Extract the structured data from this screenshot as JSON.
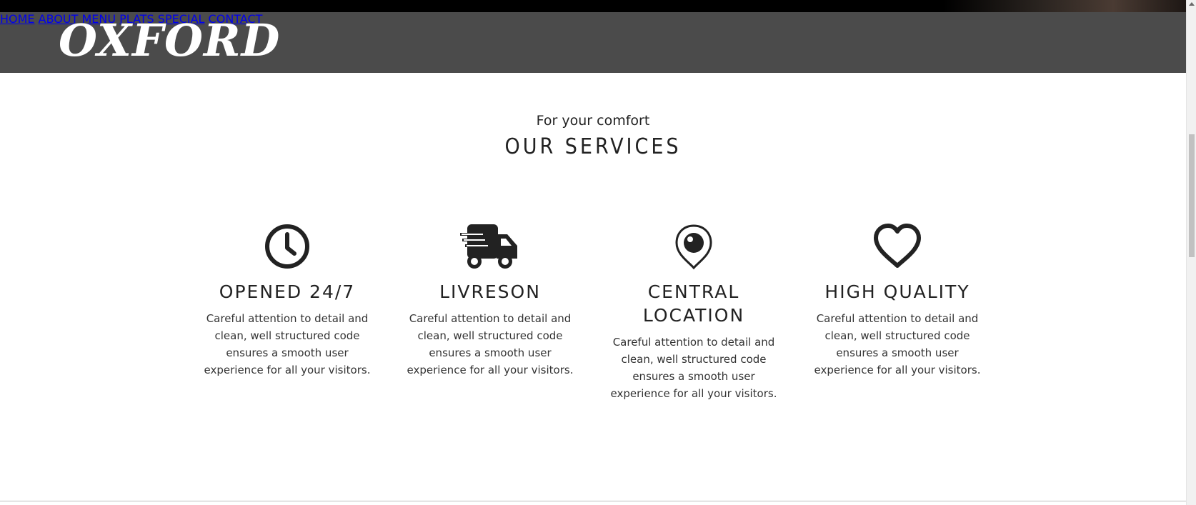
{
  "brand": {
    "logo": "OXFORD"
  },
  "nav": {
    "items": [
      {
        "label": "HOME"
      },
      {
        "label": "ABOUT"
      },
      {
        "label": "MENU"
      },
      {
        "label": "PLATS SPECIAL"
      },
      {
        "label": "CONTACT"
      }
    ]
  },
  "services": {
    "subtitle": "For your comfort",
    "title": "OUR SERVICES",
    "items": [
      {
        "icon": "clock-icon",
        "title": "OPENED 24/7",
        "description": "Careful attention to detail and clean, well structured code ensures a smooth user experience for all your visitors."
      },
      {
        "icon": "delivery-truck-icon",
        "title": "LIVRESON",
        "description": "Careful attention to detail and clean, well structured code ensures a smooth user experience for all your visitors."
      },
      {
        "icon": "location-pin-icon",
        "title": "CENTRAL LOCATION",
        "description": "Careful attention to detail and clean, well structured code ensures a smooth user experience for all your visitors."
      },
      {
        "icon": "heart-icon",
        "title": "HIGH QUALITY",
        "description": "Careful attention to detail and clean, well structured code ensures a smooth user experience for all your visitors."
      }
    ]
  },
  "colors": {
    "navbar": "#4b4b4b",
    "text": "#222222",
    "background": "#ffffff"
  }
}
